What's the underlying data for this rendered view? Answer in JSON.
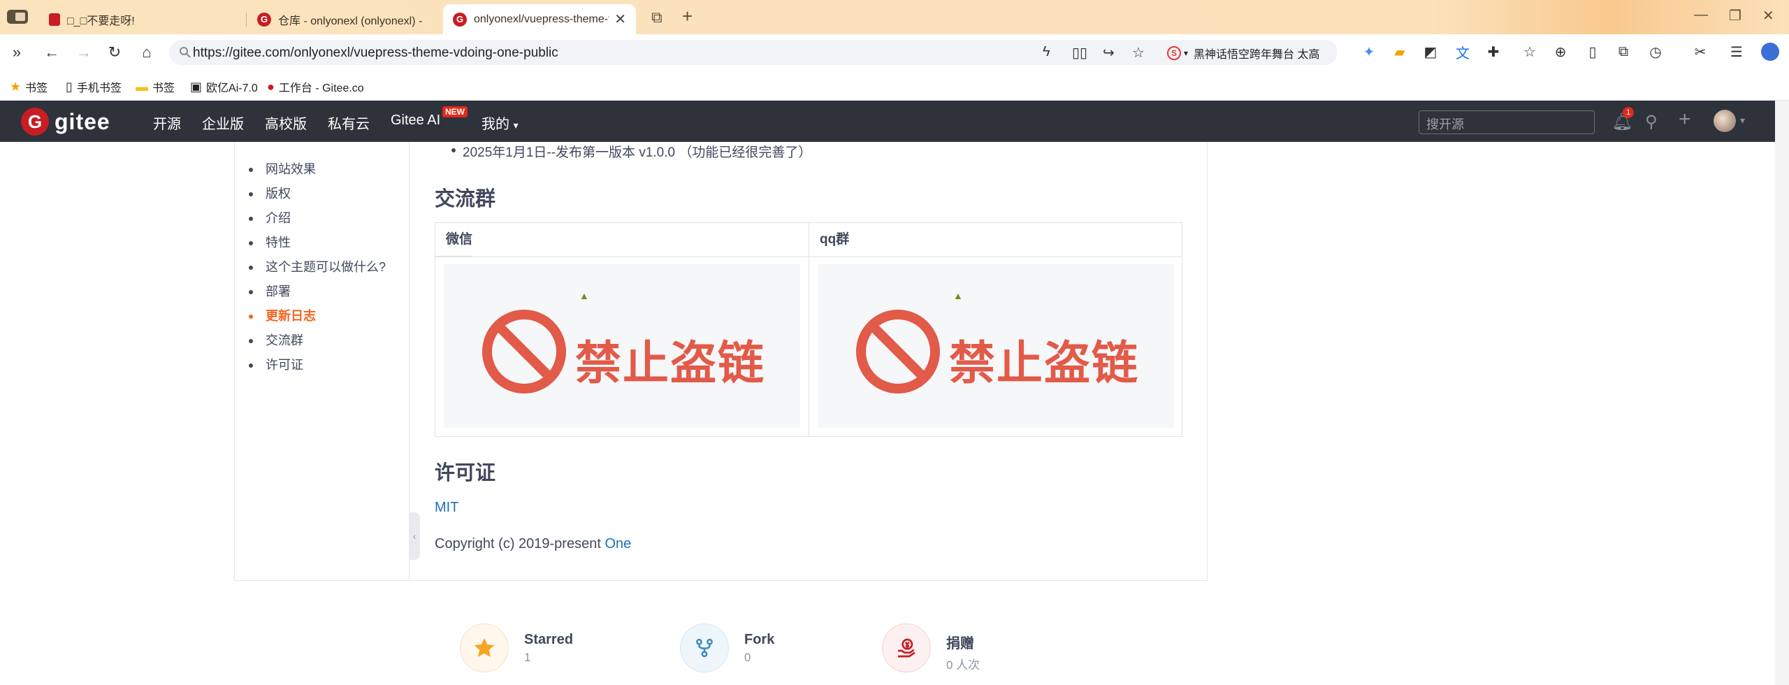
{
  "browser": {
    "tabs": [
      {
        "title": "□_□不要走呀!",
        "active": false
      },
      {
        "title": "仓库 - onlyonexl (onlyonexl) -",
        "active": false
      },
      {
        "title": "onlyonexl/vuepress-theme-v",
        "active": true
      }
    ],
    "url": "https://gitee.com/onlyonexl/vuepress-theme-vdoing-one-public",
    "search_suggestion": "黑神话悟空跨年舞台 太高",
    "bookmarks": [
      "书签",
      "手机书签",
      "书签",
      "欧亿Ai-7.0",
      "工作台 - Gitee.co"
    ]
  },
  "gitee": {
    "logo": "gitee",
    "nav": [
      "开源",
      "企业版",
      "高校版",
      "私有云",
      "Gitee AI",
      "我的"
    ],
    "new_badge": "NEW",
    "search_placeholder": "搜开源",
    "notification_count": "1"
  },
  "toc": [
    {
      "label": "网站效果",
      "active": false
    },
    {
      "label": "版权",
      "active": false
    },
    {
      "label": "介绍",
      "active": false
    },
    {
      "label": "特性",
      "active": false
    },
    {
      "label": "这个主题可以做什么?",
      "active": false
    },
    {
      "label": "部署",
      "active": false
    },
    {
      "label": "更新日志",
      "active": true
    },
    {
      "label": "交流群",
      "active": false
    },
    {
      "label": "许可证",
      "active": false
    }
  ],
  "content": {
    "changelog_item": "2025年1月1日--发布第一版本 v1.0.0 （功能已经很完善了）",
    "group_heading": "交流群",
    "table_headers": [
      "微信",
      "qq群"
    ],
    "blocked_image_text": "禁止盗链",
    "license_heading": "许可证",
    "license_link": "MIT",
    "copyright_prefix": "Copyright (c) 2019-present ",
    "copyright_owner": "One"
  },
  "stats": [
    {
      "label": "Starred",
      "value": "1"
    },
    {
      "label": "Fork",
      "value": "0"
    },
    {
      "label": "捐赠",
      "value": "0 人次"
    }
  ],
  "colors": {
    "accent": "#f6631c",
    "brand": "#c71d23",
    "link": "#1e6fb8",
    "header": "#2e323a",
    "blocked": "#e25a48"
  }
}
